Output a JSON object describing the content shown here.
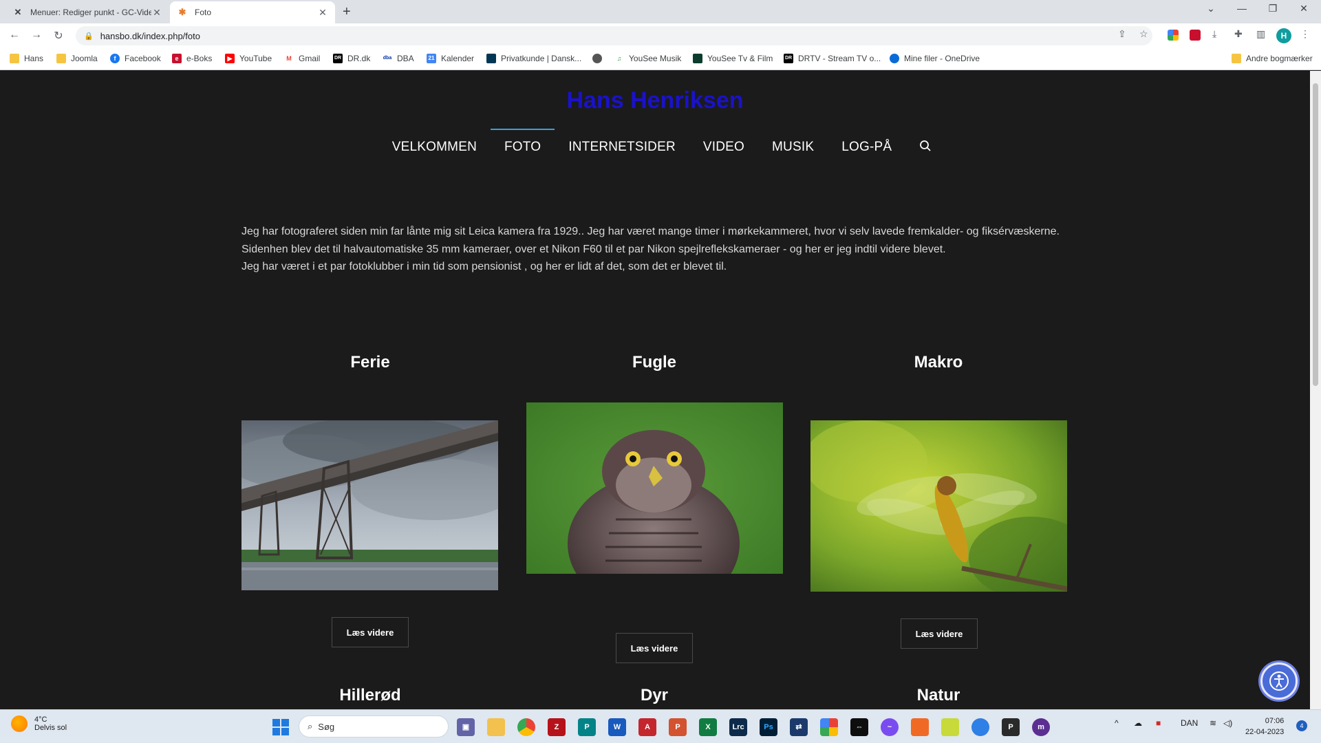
{
  "browser": {
    "tabs": [
      {
        "title": "Menuer: Rediger punkt - GC-Vide",
        "active": false
      },
      {
        "title": "Foto",
        "active": true
      }
    ],
    "url": "hansbo.dk/index.php/foto",
    "profile_initial": "H",
    "bookmarks": [
      "Hans",
      "Joomla",
      "Facebook",
      "e-Boks",
      "YouTube",
      "Gmail",
      "DR.dk",
      "DBA",
      "Kalender",
      "Privatkunde | Dansk...",
      "YouSee Musik",
      "YouSee Tv & Film",
      "DRTV - Stream TV o...",
      "Mine filer - OneDrive"
    ],
    "other_bookmarks": "Andre bogmærker"
  },
  "site": {
    "title": "Hans Henriksen",
    "title_color": "#1a12c9",
    "nav": [
      "VELKOMMEN",
      "FOTO",
      "INTERNETSIDER",
      "VIDEO",
      "MUSIK",
      "LOG-PÅ"
    ],
    "active_nav": "FOTO",
    "intro": [
      "Jeg har fotograferet siden min far lånte mig sit Leica kamera fra 1929.. Jeg har været mange timer i mørkekammeret, hvor vi selv lavede fremkalder- og fiksérvæskerne.",
      "Sidenhen blev det til halvautomatiske 35 mm kameraer, over et Nikon F60 til et par Nikon spejlreflekskameraer - og her er jeg indtil videre blevet.",
      "Jeg har været i et par fotoklubber i min tid som pensionist , og her er lidt af det, som det er blevet til."
    ],
    "categories": [
      {
        "title": "Ferie",
        "button": "Læs videre"
      },
      {
        "title": "Fugle",
        "button": "Læs videre"
      },
      {
        "title": "Makro",
        "button": "Læs videre"
      }
    ],
    "categories_row2": [
      "Hillerød",
      "Dyr",
      "Natur"
    ]
  },
  "taskbar": {
    "weather_temp": "4°C",
    "weather_desc": "Delvis sol",
    "search_placeholder": "Søg",
    "language": "DAN",
    "time": "07:06",
    "date": "22-04-2023",
    "notifications": "4"
  }
}
